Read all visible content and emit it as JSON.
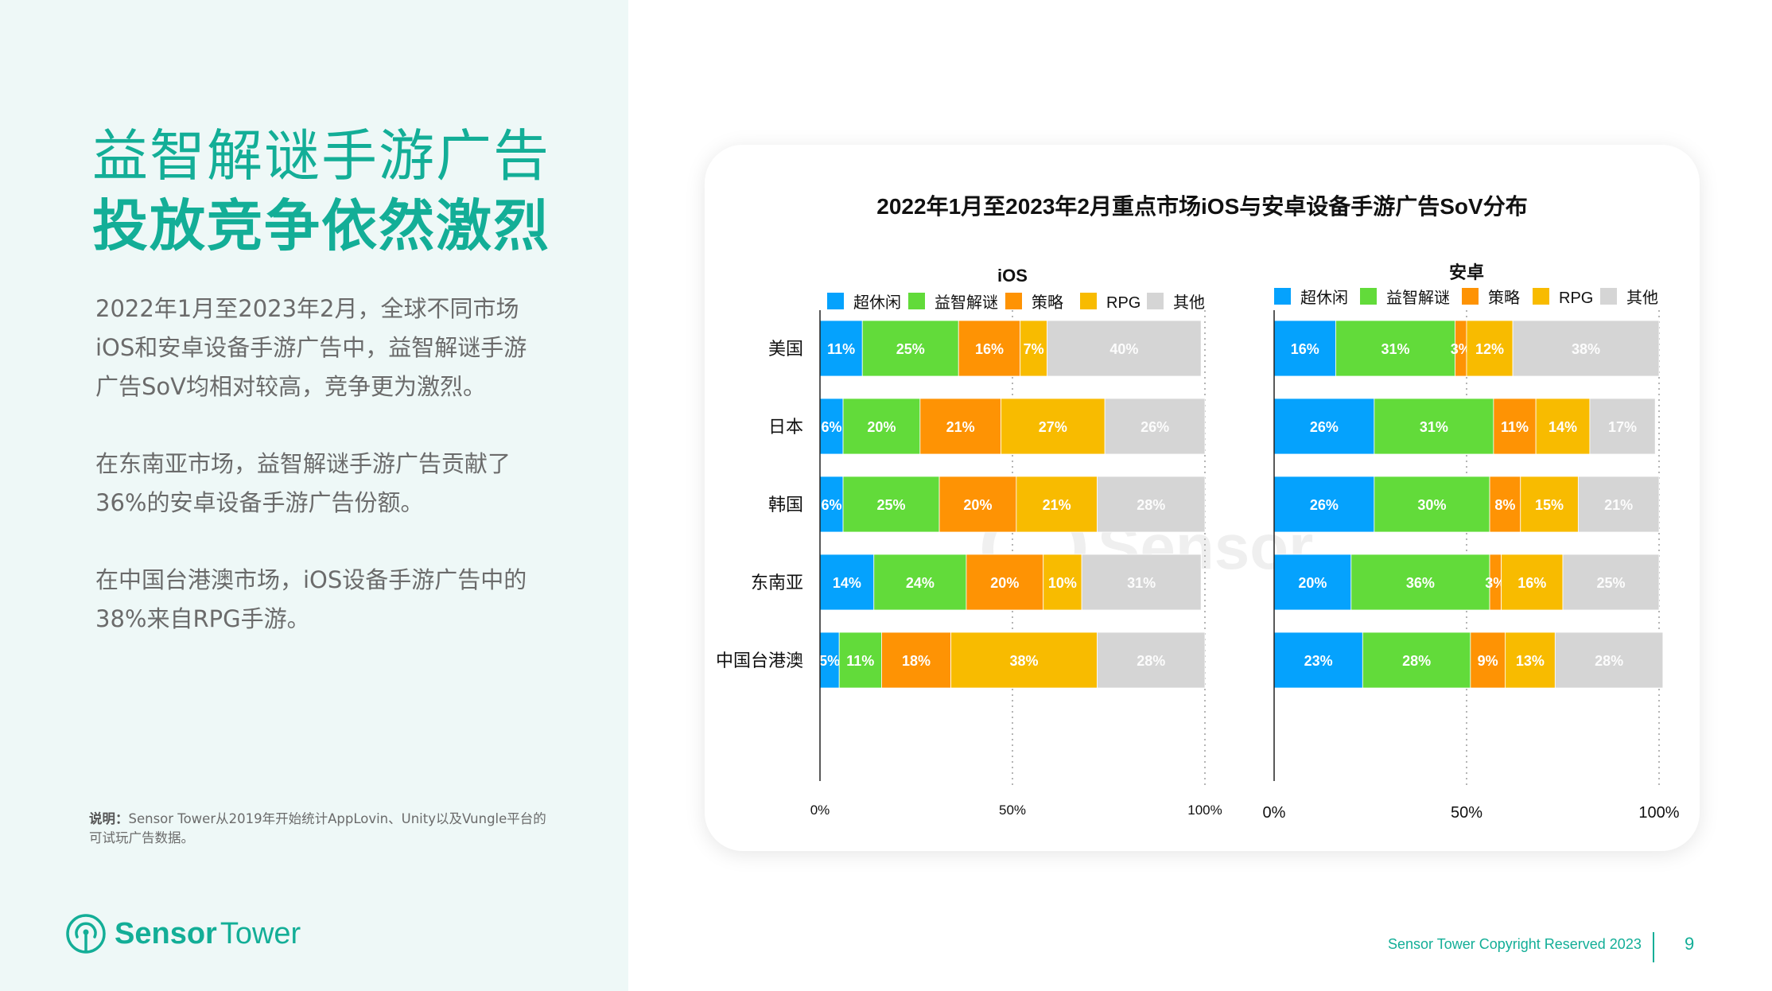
{
  "left": {
    "title_line1": "益智解谜手游广告",
    "title_line2": "投放竞争依然激烈",
    "paragraphs": [
      "2022年1月至2023年2月，全球不同市场iOS和安卓设备手游广告中，益智解谜手游广告SoV均相对较高，竞争更为激烈。",
      "在东南亚市场，益智解谜手游广告贡献了36%的安卓设备手游广告份额。",
      "在中国台港澳市场，iOS设备手游广告中的38%来自RPG手游。"
    ],
    "note_label": "说明：",
    "note_text": "Sensor Tower从2019年开始统计AppLovin、Unity以及Vungle平台的可试玩广告数据。",
    "logo_bold": "Sensor",
    "logo_regular": "Tower",
    "logo_icon": "sensor-tower-logo-icon"
  },
  "footer": {
    "copyright": "Sensor Tower Copyright Reserved 2023",
    "page_number": "9"
  },
  "colors": {
    "accent": "#13ae97",
    "left_bg": "#eef8f7"
  },
  "chart_data": {
    "type": "bar",
    "orientation": "horizontal-stacked-100",
    "title": "2022年1月至2023年2月重点市场iOS与安卓设备手游广告SoV分布",
    "legend_items": [
      "超休闲",
      "益智解谜",
      "策略",
      "RPG",
      "其他"
    ],
    "legend_colors": [
      "#05a2fd",
      "#62db3a",
      "#fe9304",
      "#f8bb00",
      "#d5d5d5"
    ],
    "legend_placement": "top",
    "categories": [
      "美国",
      "日本",
      "韩国",
      "东南亚",
      "中国台港澳"
    ],
    "xticks": [
      "0%",
      "50%",
      "100%"
    ],
    "xlim": [
      0,
      100
    ],
    "grid": "dotted vertical at 50% and 100%",
    "panels": [
      {
        "name": "iOS",
        "series": [
          {
            "name": "超休闲",
            "values": [
              11,
              6,
              6,
              14,
              5
            ]
          },
          {
            "name": "益智解谜",
            "values": [
              25,
              20,
              25,
              24,
              11
            ]
          },
          {
            "name": "策略",
            "values": [
              16,
              21,
              20,
              20,
              18
            ]
          },
          {
            "name": "RPG",
            "values": [
              7,
              27,
              21,
              10,
              38
            ]
          },
          {
            "name": "其他",
            "values": [
              40,
              26,
              28,
              31,
              28
            ]
          }
        ]
      },
      {
        "name": "安卓",
        "series": [
          {
            "name": "超休闲",
            "values": [
              16,
              26,
              26,
              20,
              23
            ]
          },
          {
            "name": "益智解谜",
            "values": [
              31,
              31,
              30,
              36,
              28
            ]
          },
          {
            "name": "策略",
            "values": [
              3,
              11,
              8,
              3,
              9
            ]
          },
          {
            "name": "RPG",
            "values": [
              12,
              14,
              15,
              16,
              13
            ]
          },
          {
            "name": "其他",
            "values": [
              38,
              17,
              21,
              25,
              28
            ]
          }
        ]
      }
    ],
    "watermark": "SensorTower"
  }
}
